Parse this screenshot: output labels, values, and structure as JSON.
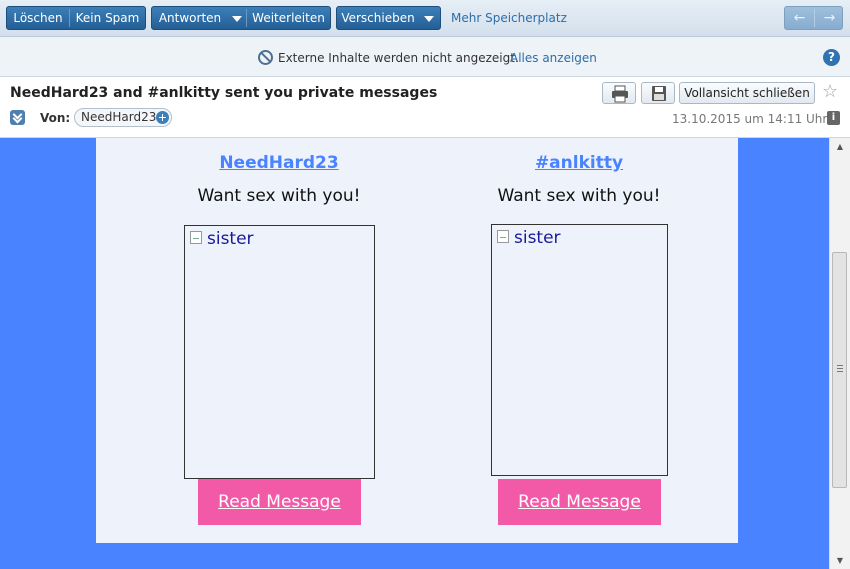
{
  "toolbar": {
    "delete_label": "Löschen",
    "not_spam_label": "Kein Spam",
    "reply_label": "Antworten",
    "forward_label": "Weiterleiten",
    "move_label": "Verschieben",
    "more_storage_label": "Mehr Speicherplatz",
    "prev_arrow": "←",
    "next_arrow": "→"
  },
  "infobar": {
    "text": "Externe Inhalte werden nicht angezeigt.",
    "show_all_label": "Alles anzeigen",
    "help_label": "?"
  },
  "header": {
    "subject": "NeedHard23 and #anlkitty sent you private messages",
    "close_full_view_label": "Vollansicht schließen",
    "from_label": "Von:",
    "sender": "NeedHard23",
    "date": "13.10.2015 um 14:11 Uhr",
    "info_label": "i"
  },
  "message": {
    "background_color": "#4a83ff",
    "button_color": "#f25aa8",
    "profiles": [
      {
        "username": "NeedHard23",
        "tagline": "Want sex with you!",
        "image_alt": "sister",
        "button_label": "Read Message"
      },
      {
        "username": "#anlkitty",
        "tagline": "Want sex with you!",
        "image_alt": "sister",
        "button_label": "Read Message"
      }
    ]
  },
  "icons": {
    "print": "printer-icon",
    "save": "floppy-disk-icon",
    "star": "star-icon",
    "blocked": "blocked-content-icon",
    "help": "help-icon"
  }
}
